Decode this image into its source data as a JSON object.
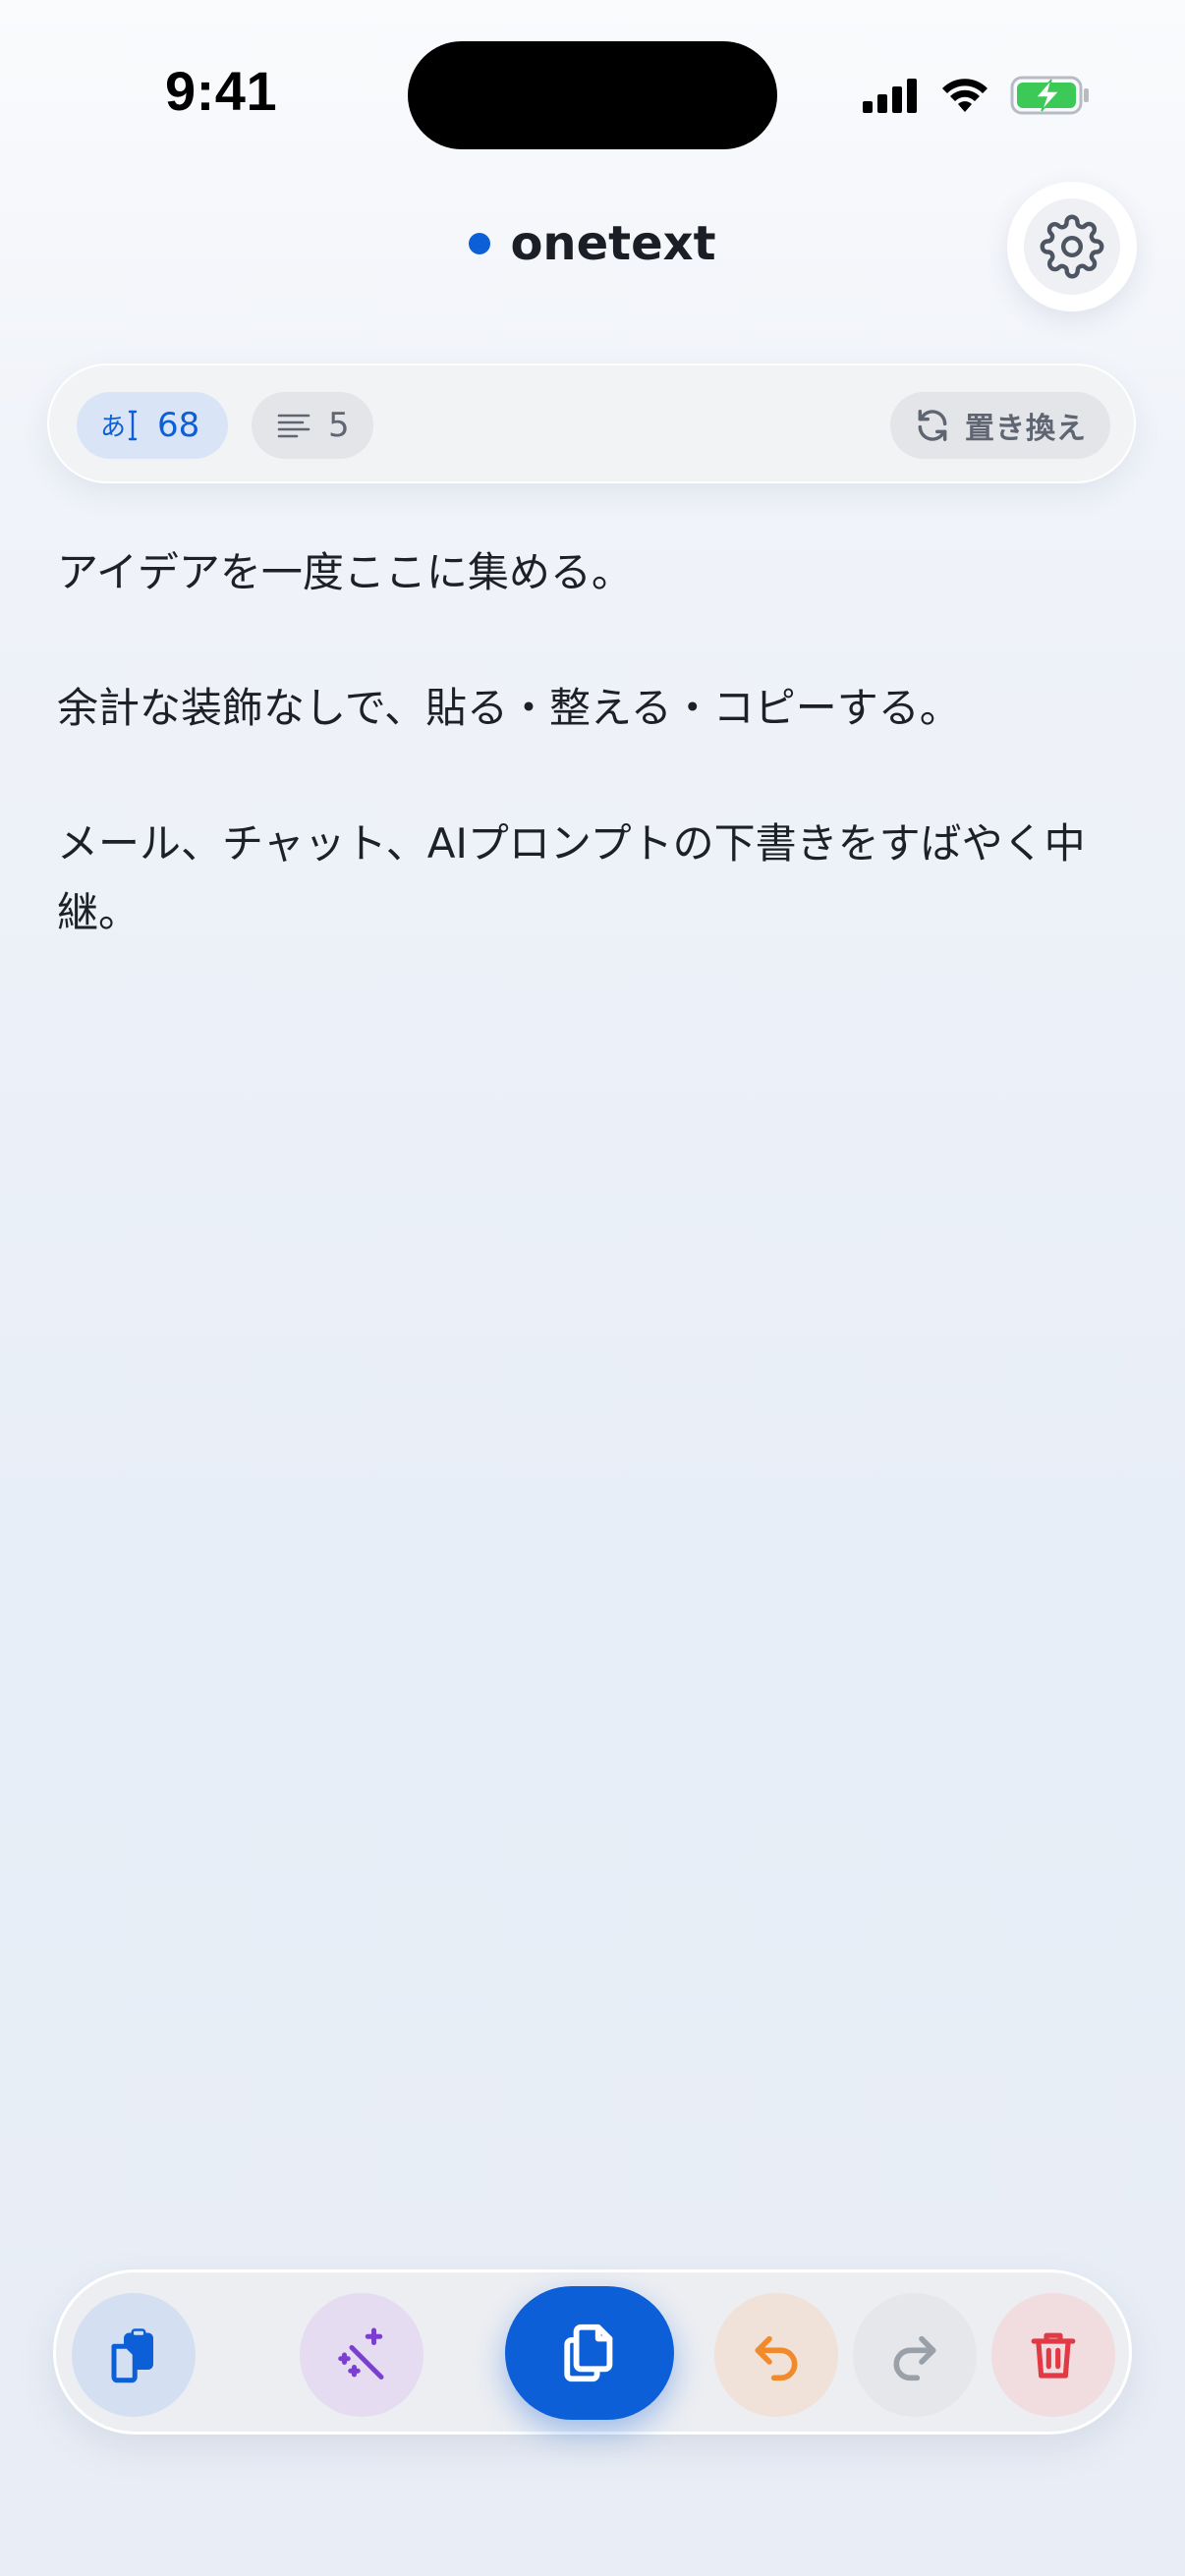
{
  "status_bar": {
    "time": "9:41"
  },
  "header": {
    "title": "onetext",
    "accent_color": "#0d5fd8"
  },
  "stats": {
    "char_icon": "あ",
    "char_count": "68",
    "line_count": "5",
    "replace_label": "置き換え"
  },
  "editor": {
    "paragraphs": [
      "アイデアを一度ここに集める。",
      "余計な装飾なしで、貼る・整える・コピーする。",
      "メール、チャット、AIプロンプトの下書きをすばやく中継。"
    ]
  },
  "toolbar": {
    "buttons": [
      "paste",
      "magic",
      "copy",
      "undo",
      "redo",
      "delete"
    ],
    "icons": [
      "paste-icon",
      "magic-wand-icon",
      "copy-icon",
      "undo-icon",
      "redo-icon",
      "trash-icon"
    ],
    "colors": {
      "paste": "#0d5fd8",
      "magic": "#7b3fd0",
      "copy": "#0d5fd8",
      "undo": "#f08a2a",
      "redo": "#9aa0a8",
      "delete": "#e23a44"
    }
  }
}
